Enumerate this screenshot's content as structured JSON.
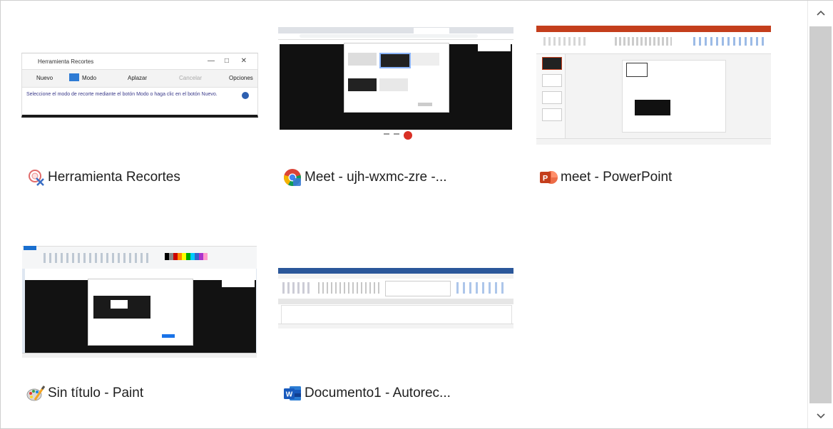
{
  "windows": [
    {
      "title": "Herramienta Recortes",
      "icon": "snipping-tool-icon"
    },
    {
      "title": "Meet - ujh-wxmc-zre -...",
      "icon": "chrome-icon"
    },
    {
      "title": "meet - PowerPoint",
      "icon": "powerpoint-icon"
    },
    {
      "title": "Sin título - Paint",
      "icon": "paint-icon"
    },
    {
      "title": "Documento1 -  Autorec...",
      "icon": "word-icon"
    }
  ],
  "snipping_preview": {
    "title": "Herramienta Recortes",
    "toolbar": [
      "Nuevo",
      "Modo",
      "Aplazar",
      "Cancelar",
      "Opciones"
    ],
    "hint": "Seleccione el modo de recorte mediante el botón Modo o haga clic en el botón Nuevo."
  },
  "scrollbar": {
    "up_icon": "chevron-up-icon",
    "down_icon": "chevron-down-icon"
  }
}
